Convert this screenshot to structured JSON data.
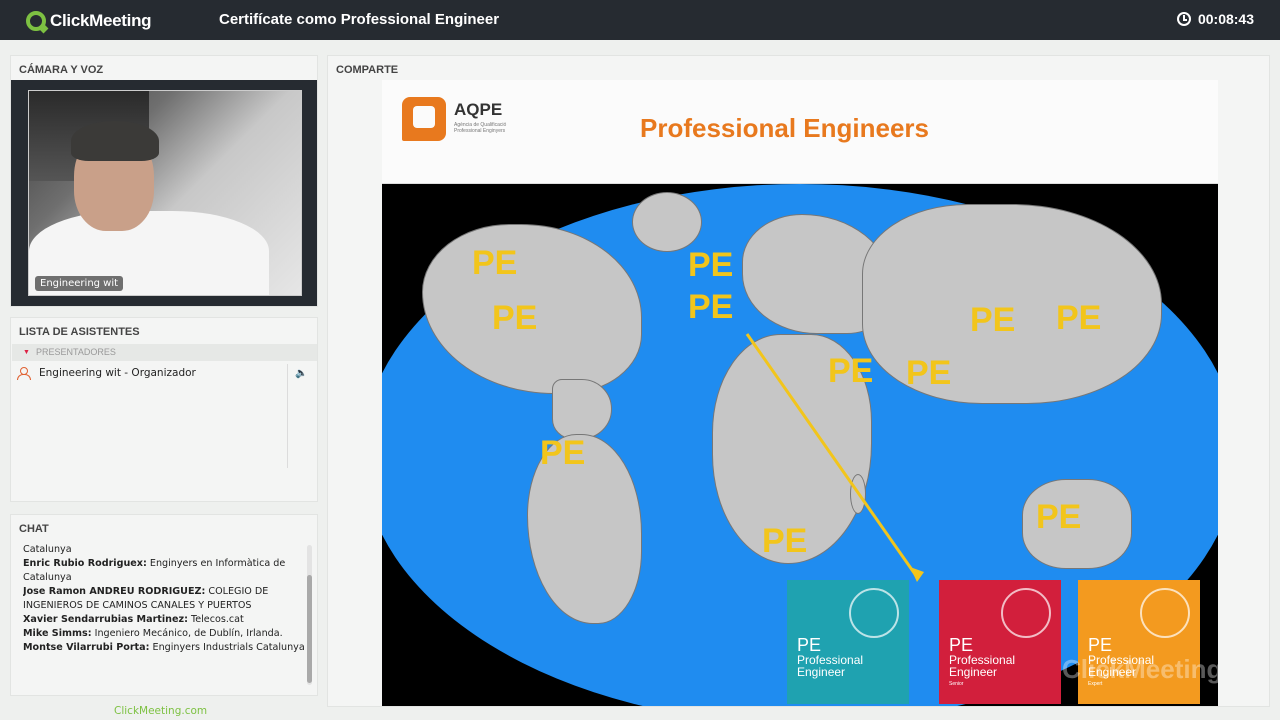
{
  "topbar": {
    "app_name": "ClickMeeting",
    "meeting_title": "Certifícate como Professional Engineer",
    "timer": "00:08:43"
  },
  "camera": {
    "title": "CÁMARA Y VOZ",
    "participant_label": "Engineering wit"
  },
  "attendees": {
    "title": "LISTA DE ASISTENTES",
    "section": "PRESENTADORES",
    "items": [
      {
        "name": "Engineering wit - Organizador"
      }
    ]
  },
  "chat": {
    "title": "CHAT",
    "messages": [
      {
        "author": "",
        "text": "Catalunya"
      },
      {
        "author": "Enric Rubio Rodriguex:",
        "text": "Enginyers en Informàtica de Catalunya"
      },
      {
        "author": "Jose Ramon ANDREU RODRIGUEZ:",
        "text": "COLEGIO DE INGENIEROS DE CAMINOS CANALES Y PUERTOS"
      },
      {
        "author": "Xavier Sendarrubias Martinez:",
        "text": "Telecos.cat"
      },
      {
        "author": "Mike Simms:",
        "text": "Ingeniero Mecánico, de Dublín, Irlanda."
      },
      {
        "author": "Montse Vilarrubi Porta:",
        "text": "Enginyers Industrials Catalunya"
      }
    ]
  },
  "footer": {
    "link": "ClickMeeting.com"
  },
  "share": {
    "title": "COMPARTE",
    "slide": {
      "logo_name": "AQPE",
      "logo_subtitle": "Agència de Qualificació Professional Enginyers",
      "heading": "Professional Engineers",
      "map_labels": [
        "PE",
        "PE",
        "PE",
        "PE",
        "PE",
        "PE",
        "PE",
        "PE",
        "PE",
        "PE",
        "PE"
      ],
      "certificates": [
        {
          "pe": "PE",
          "line1": "Professional",
          "line2": "Engineer",
          "grade": "",
          "color": "#1fa2b0"
        },
        {
          "pe": "PE",
          "line1": "Professional",
          "line2": "Engineer",
          "grade": "Senior",
          "color": "#d21f3c"
        },
        {
          "pe": "PE",
          "line1": "Professional",
          "line2": "Engineer",
          "grade": "Expert",
          "color": "#f39a1f"
        }
      ],
      "watermark": "ClickMeeting"
    }
  },
  "colors": {
    "accent": "#7dc142",
    "topbar": "#262b31",
    "ocean": "#1f8cf0",
    "pe_label": "#f2c51b",
    "slide_heading": "#e8791e"
  }
}
